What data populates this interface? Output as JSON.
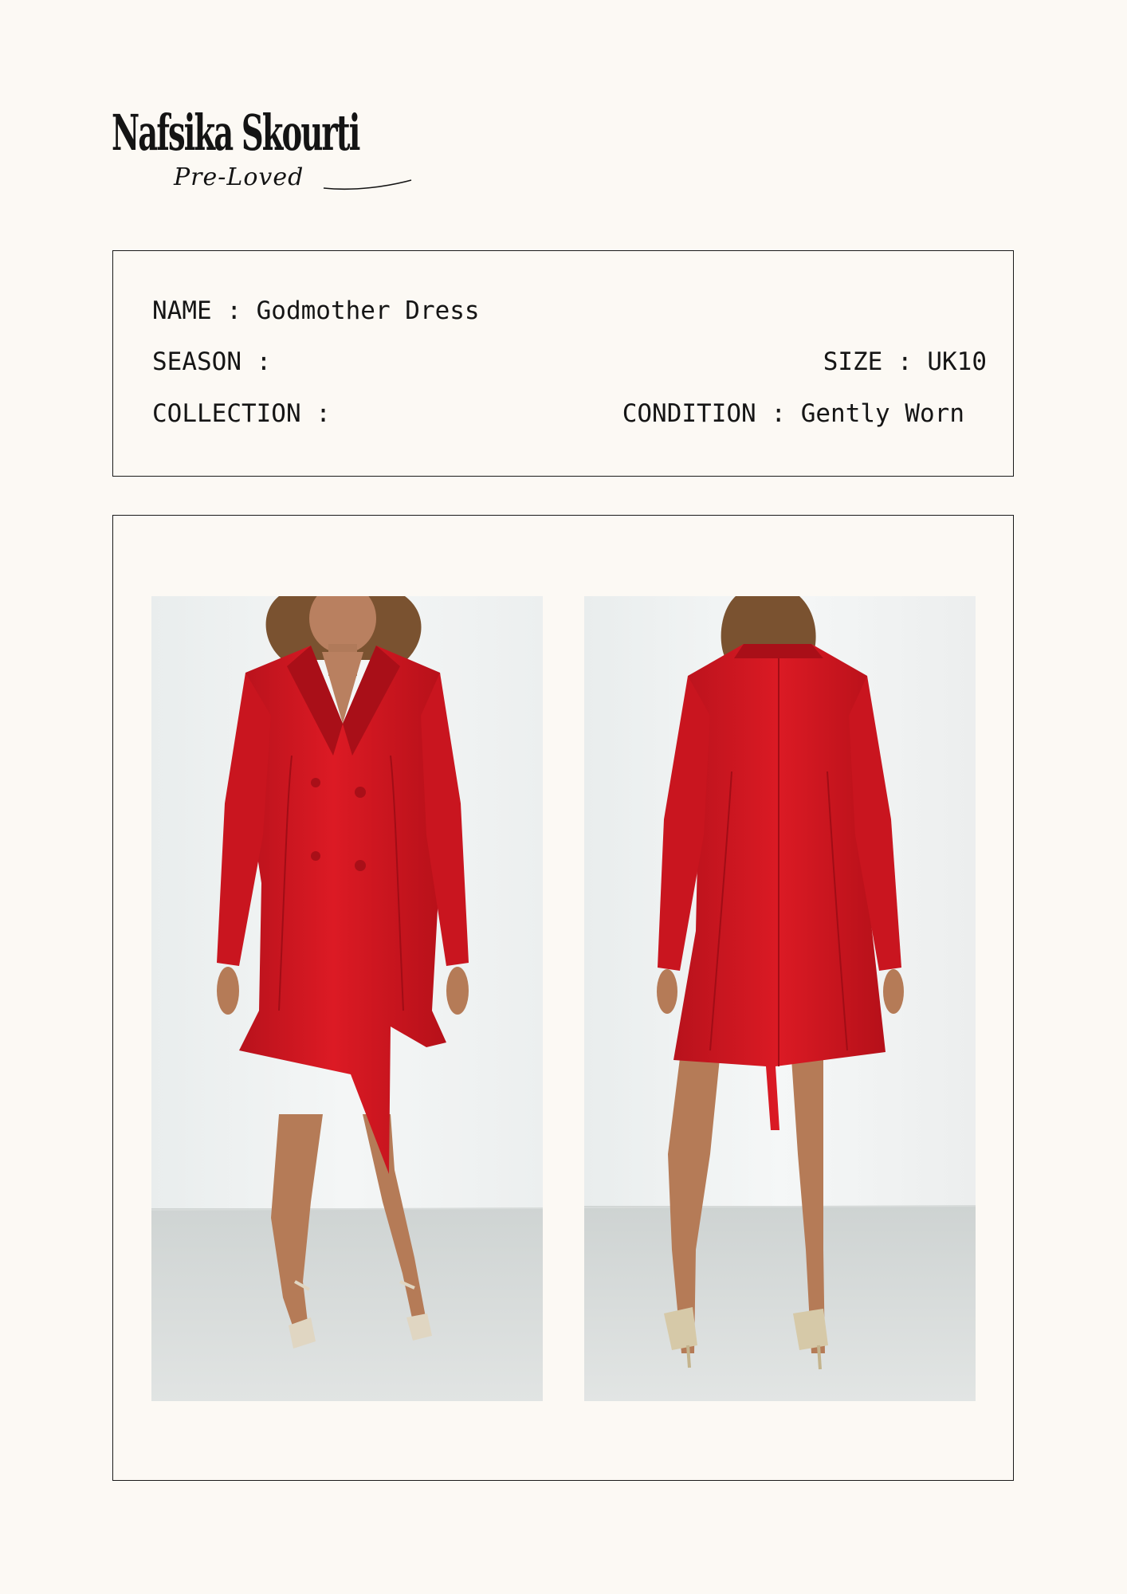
{
  "brand": {
    "name": "Nafsika Skourti",
    "subline": "Pre-Loved"
  },
  "product": {
    "name_label": "NAME : Godmother Dress",
    "season_label": "SEASON :",
    "size_label": "SIZE : UK10",
    "collection_label": "COLLECTION :",
    "condition_label": "CONDITION : Gently Worn"
  },
  "photos": [
    {
      "view": "front",
      "icon": "dress-front-photo"
    },
    {
      "view": "back",
      "icon": "dress-back-photo"
    }
  ],
  "colors": {
    "background": "#fcf9f4",
    "dress_red": "#d41822",
    "border": "#1a1a1a"
  }
}
